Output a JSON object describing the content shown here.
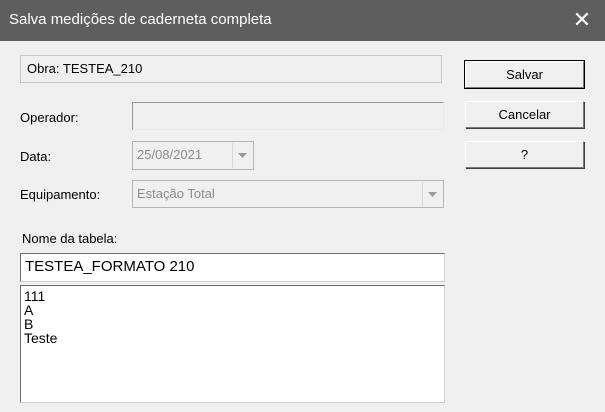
{
  "window": {
    "title": "Salva medições de caderneta completa",
    "close_glyph": "✕"
  },
  "obra": {
    "text": "Obra: TESTEA_210"
  },
  "form": {
    "operador_label": "Operador:",
    "operador_value": "",
    "data_label": "Data:",
    "data_value": "25/08/2021",
    "equipamento_label": "Equipamento:",
    "equipamento_value": "Estação Total",
    "nome_tabela_label": "Nome da tabela:",
    "nome_tabela_value": "TESTEA_FORMATO 210"
  },
  "tables_list": [
    "111",
    "A",
    "B",
    "Teste"
  ],
  "buttons": {
    "save_label": "Salvar",
    "cancel_label": "Cancelar",
    "help_label": "?"
  },
  "icons": {
    "close": "close-icon",
    "dropdown": "chevron-down-icon"
  },
  "colors": {
    "titlebar": "#5e5e5e",
    "dialog_bg": "#f0f0f0",
    "disabled_text": "#8c8c8c"
  }
}
